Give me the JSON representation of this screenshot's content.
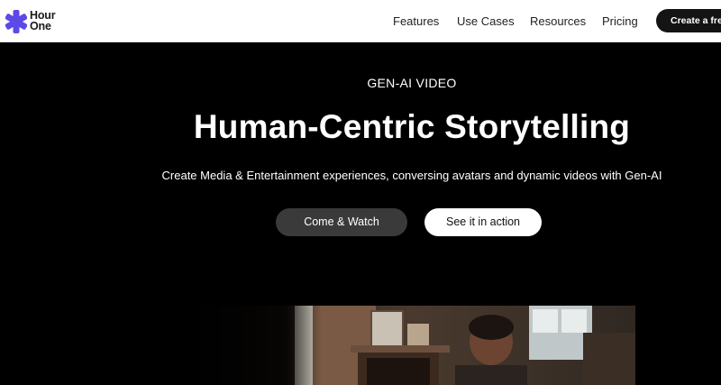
{
  "brand": {
    "logo_line1": "Hour",
    "logo_line2": "One",
    "accent": "#5b4ae6"
  },
  "nav": {
    "items": [
      "Features",
      "Use Cases",
      "Resources",
      "Pricing"
    ],
    "cta_label": "Create a free"
  },
  "hero": {
    "eyebrow": "GEN-AI VIDEO",
    "headline": "Human-Centric Storytelling",
    "subhead": "Create Media & Entertainment experiences, conversing avatars and dynamic videos with Gen-AI",
    "primary_button": "Come & Watch",
    "secondary_button": "See it in action"
  },
  "colors": {
    "background": "#000000",
    "header_bg": "#ffffff",
    "dark_button": "#3a3a3a"
  }
}
